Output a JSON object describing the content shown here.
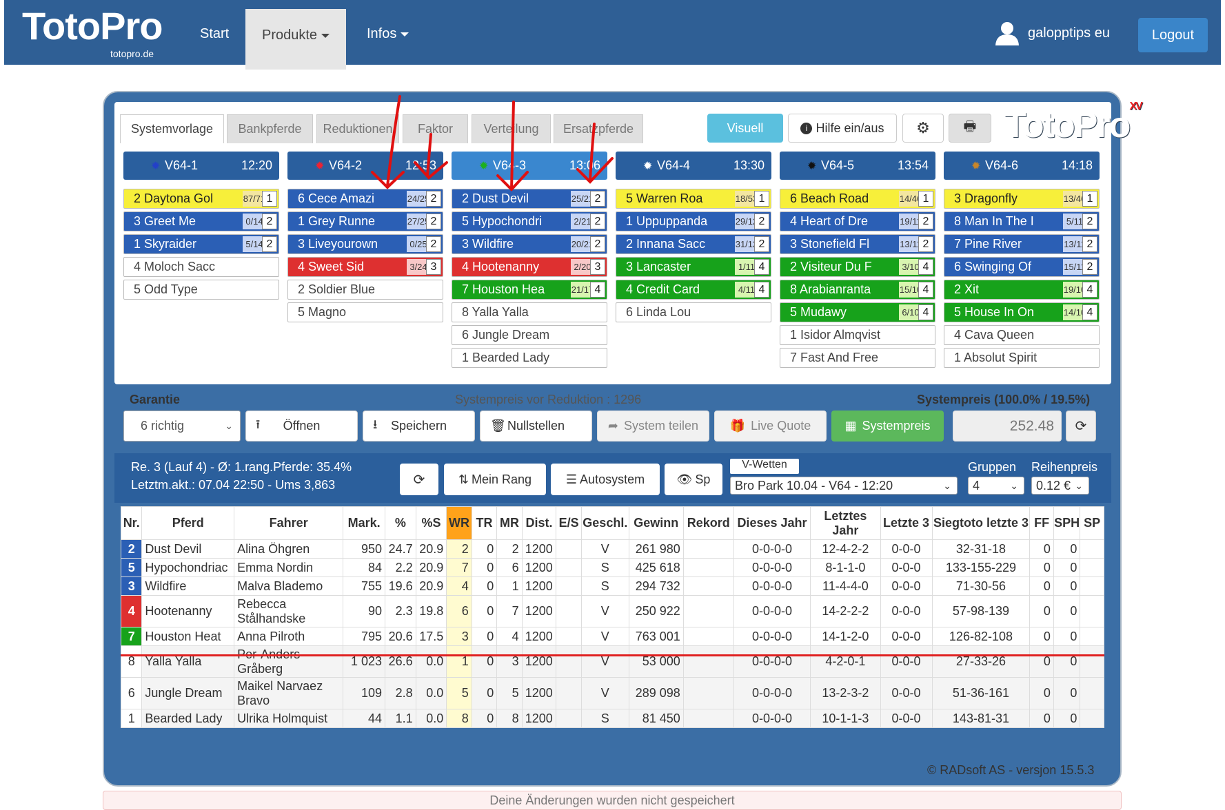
{
  "app": {
    "logo": "TotoPro",
    "logo_sub": "totopro.de",
    "nav": [
      "Start",
      "Produkte",
      "Infos"
    ],
    "user": "galopptips eu",
    "logout": "Logout"
  },
  "tabs": [
    "Systemvorlage",
    "Bankpferde",
    "Reduktionen",
    "Faktor",
    "Verteilung",
    "Ersatzpferde"
  ],
  "toolbar": {
    "visuell": "Visuell",
    "hilfe": "Hilfe ein/aus",
    "brand": "TotoPro",
    "brand_sup": "XV"
  },
  "races": [
    {
      "label": "V64-1",
      "time": "12:20",
      "dot": "#2340c8"
    },
    {
      "label": "V64-2",
      "time": "12:53",
      "dot": "#e23"
    },
    {
      "label": "V64-3",
      "time": "13:06",
      "dot": "#1db01d"
    },
    {
      "label": "V64-4",
      "time": "13:30",
      "dot": "#ffffff"
    },
    {
      "label": "V64-5",
      "time": "13:54",
      "dot": "#111111"
    },
    {
      "label": "V64-6",
      "time": "14:18",
      "dot": "#c8862a"
    }
  ],
  "horses": [
    [
      {
        "n": "2 Daytona Gol",
        "p": "87/71",
        "r": "1",
        "c": "y"
      },
      {
        "n": "3 Greet Me",
        "p": "0/14",
        "r": "2",
        "c": "b"
      },
      {
        "n": "1 Skyraider",
        "p": "5/14",
        "r": "2",
        "c": "b"
      },
      {
        "n": "4 Moloch Sacc",
        "p": "",
        "r": "",
        "c": ""
      },
      {
        "n": "5 Odd Type",
        "p": "",
        "r": "",
        "c": ""
      }
    ],
    [
      {
        "n": "6 Cece Amazi",
        "p": "24/25",
        "r": "2",
        "c": "b"
      },
      {
        "n": "1 Grey Runne",
        "p": "27/25",
        "r": "2",
        "c": "b"
      },
      {
        "n": "3 Liveyourown",
        "p": "0/25",
        "r": "2",
        "c": "b"
      },
      {
        "n": "4 Sweet Sid",
        "p": "3/24",
        "r": "3",
        "c": "r"
      },
      {
        "n": "2 Soldier Blue",
        "p": "",
        "r": "",
        "c": ""
      },
      {
        "n": "5 Magno",
        "p": "",
        "r": "",
        "c": ""
      }
    ],
    [
      {
        "n": "2 Dust Devil",
        "p": "25/21",
        "r": "2",
        "c": "b"
      },
      {
        "n": "5 Hypochondri",
        "p": "2/21",
        "r": "2",
        "c": "b"
      },
      {
        "n": "3 Wildfire",
        "p": "20/21",
        "r": "2",
        "c": "b"
      },
      {
        "n": "4 Hootenanny",
        "p": "2/20",
        "r": "3",
        "c": "r"
      },
      {
        "n": "7 Houston Hea",
        "p": "21/17",
        "r": "4",
        "c": "g"
      },
      {
        "n": "8 Yalla Yalla",
        "p": "",
        "r": "",
        "c": ""
      },
      {
        "n": "6 Jungle Dream",
        "p": "",
        "r": "",
        "c": ""
      },
      {
        "n": "1 Bearded Lady",
        "p": "",
        "r": "",
        "c": ""
      }
    ],
    [
      {
        "n": "5 Warren Roa",
        "p": "18/53",
        "r": "1",
        "c": "y"
      },
      {
        "n": "1 Uppuppanda",
        "p": "29/12",
        "r": "2",
        "c": "b"
      },
      {
        "n": "2 Innana Sacc",
        "p": "31/12",
        "r": "2",
        "c": "b"
      },
      {
        "n": "3 Lancaster",
        "p": "1/11",
        "r": "4",
        "c": "g"
      },
      {
        "n": "4 Credit Card",
        "p": "4/11",
        "r": "4",
        "c": "g"
      },
      {
        "n": "6 Linda Lou",
        "p": "",
        "r": "",
        "c": ""
      }
    ],
    [
      {
        "n": "6 Beach Road",
        "p": "14/46",
        "r": "1",
        "c": "y"
      },
      {
        "n": "4 Heart of Dre",
        "p": "19/11",
        "r": "2",
        "c": "b"
      },
      {
        "n": "3 Stonefield Fl",
        "p": "13/11",
        "r": "2",
        "c": "b"
      },
      {
        "n": "2 Visiteur Du F",
        "p": "3/10",
        "r": "4",
        "c": "g"
      },
      {
        "n": "8 Arabianranta",
        "p": "15/10",
        "r": "4",
        "c": "g"
      },
      {
        "n": "5 Mudawy",
        "p": "6/10",
        "r": "4",
        "c": "g"
      },
      {
        "n": "1 Isidor Almqvist",
        "p": "",
        "r": "",
        "c": ""
      },
      {
        "n": "7 Fast And Free",
        "p": "",
        "r": "",
        "c": ""
      }
    ],
    [
      {
        "n": "3 Dragonfly",
        "p": "13/46",
        "r": "1",
        "c": "y"
      },
      {
        "n": "8 Man In The I",
        "p": "5/11",
        "r": "2",
        "c": "b"
      },
      {
        "n": "7 Pine River",
        "p": "13/11",
        "r": "2",
        "c": "b"
      },
      {
        "n": "6 Swinging Of",
        "p": "15/11",
        "r": "2",
        "c": "b"
      },
      {
        "n": "2 Xit",
        "p": "19/10",
        "r": "4",
        "c": "g"
      },
      {
        "n": "5 House In On",
        "p": "14/10",
        "r": "4",
        "c": "g"
      },
      {
        "n": "4 Cava Queen",
        "p": "",
        "r": "",
        "c": ""
      },
      {
        "n": "1 Absolut Spirit",
        "p": "",
        "r": "",
        "c": ""
      }
    ]
  ],
  "garantie": {
    "label": "Garantie",
    "value": "6 richtig",
    "preis_vor": "Systempreis vor Reduktion : 1296",
    "preis": "Systempreis (100.0% / 19.5%)",
    "price_value": "252.48"
  },
  "actions": [
    "Öffnen",
    "Speichern",
    "Nullstellen",
    "System teilen",
    "Live Quote",
    "Systempreis"
  ],
  "info": {
    "line1": "Re. 3 (Lauf 4) - Ø: 1.rang.Pferde: 35.4%",
    "line2": "Letztm.akt.: 07.04 22:50 - Ums 3,863",
    "meinrang": "Mein Rang",
    "autosystem": "Autosystem",
    "sp": "Sp",
    "vwetten": "V-Wetten",
    "vwetten_value": "Bro Park 10.04 - V64 - 12:20",
    "gruppen": "Gruppen",
    "gruppen_value": "4",
    "reihenpreis": "Reihenpreis",
    "reihenpreis_value": "0.12 €"
  },
  "table": {
    "headers": [
      "Nr.",
      "Pferd",
      "Fahrer",
      "Mark.",
      "%",
      "%S",
      "WR",
      "TR",
      "MR",
      "Dist.",
      "E/S",
      "Geschl.",
      "Gewinn",
      "Rekord",
      "Dieses Jahr",
      "Letztes Jahr",
      "Letzte 3",
      "Siegtoto letzte 3",
      "FF",
      "SPH",
      "SP"
    ],
    "rows": [
      [
        "2",
        "Dust Devil",
        "Alina Öhgren",
        "950",
        "24.7",
        "20.9",
        "2",
        "0",
        "2",
        "1200",
        "",
        "V",
        "261 980",
        "",
        "0-0-0-0",
        "12-4-2-2",
        "0-0-0",
        "32-31-18",
        "0",
        "0",
        ""
      ],
      [
        "5",
        "Hypochondriac",
        "Emma Nordin",
        "84",
        "2.2",
        "20.9",
        "7",
        "0",
        "6",
        "1200",
        "",
        "S",
        "425 618",
        "",
        "0-0-0-0",
        "8-1-1-0",
        "0-0-0",
        "133-155-229",
        "0",
        "0",
        ""
      ],
      [
        "3",
        "Wildfire",
        "Malva Blademo",
        "755",
        "19.6",
        "20.9",
        "4",
        "0",
        "1",
        "1200",
        "",
        "S",
        "294 732",
        "",
        "0-0-0-0",
        "11-4-4-0",
        "0-0-0",
        "71-30-56",
        "0",
        "0",
        ""
      ],
      [
        "4",
        "Hootenanny",
        "Rebecca Stålhandske",
        "90",
        "2.3",
        "19.8",
        "6",
        "0",
        "7",
        "1200",
        "",
        "V",
        "250 922",
        "",
        "0-0-0-0",
        "14-2-2-2",
        "0-0-0",
        "57-98-139",
        "0",
        "0",
        ""
      ],
      [
        "7",
        "Houston Heat",
        "Anna Pilroth",
        "795",
        "20.6",
        "17.5",
        "3",
        "0",
        "4",
        "1200",
        "",
        "V",
        "763 001",
        "",
        "0-0-0-0",
        "14-1-2-0",
        "0-0-0",
        "126-82-108",
        "0",
        "0",
        ""
      ],
      [
        "8",
        "Yalla Yalla",
        "Per-Anders Gråberg",
        "1 023",
        "26.6",
        "0.0",
        "1",
        "0",
        "3",
        "1200",
        "",
        "V",
        "53 000",
        "",
        "0-0-0-0",
        "4-2-0-1",
        "0-0-0",
        "27-33-26",
        "0",
        "0",
        ""
      ],
      [
        "6",
        "Jungle Dream",
        "Maikel Narvaez Bravo",
        "109",
        "2.8",
        "0.0",
        "5",
        "0",
        "5",
        "1200",
        "",
        "V",
        "289 098",
        "",
        "0-0-0-0",
        "13-2-3-2",
        "0-0-0",
        "51-36-161",
        "0",
        "0",
        ""
      ],
      [
        "1",
        "Bearded Lady",
        "Ulrika Holmquist",
        "44",
        "1.1",
        "0.0",
        "8",
        "0",
        "8",
        "1200",
        "",
        "S",
        "81 450",
        "",
        "0-0-0-0",
        "10-1-1-3",
        "0-0-0",
        "143-81-31",
        "0",
        "0",
        ""
      ]
    ],
    "rowcolors": [
      "#2b5fb5",
      "#2b5fb5",
      "#2b5fb5",
      "#de3030",
      "#17a21b",
      "",
      "",
      ""
    ]
  },
  "footer": {
    "copyright": "© RADsoft AS - versjon 15.5.3",
    "notice": "Deine Änderungen wurden nicht gespeichert"
  }
}
